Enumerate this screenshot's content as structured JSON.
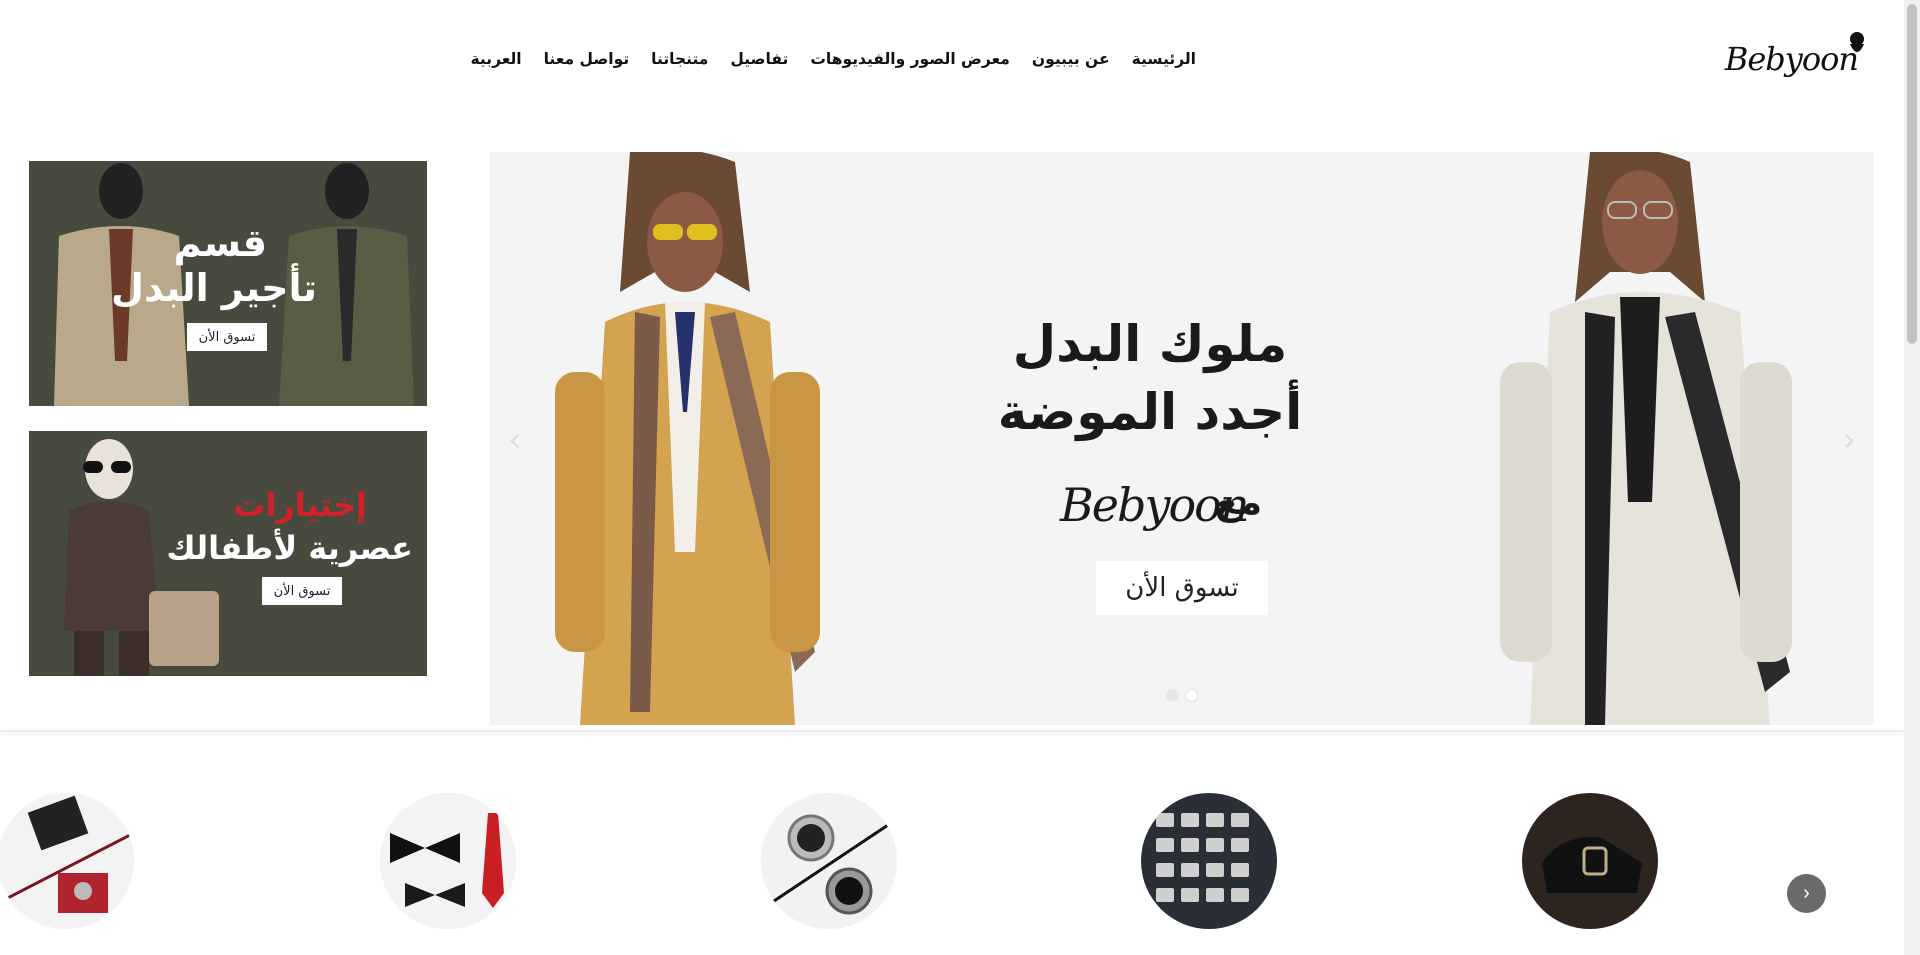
{
  "header": {
    "logo_text": "Bebyoon",
    "nav": [
      "الرئيسية",
      "عن بيبيون",
      "معرض الصور والفيديوهات",
      "تفاصيل",
      "متنجاتنا",
      "تواصل معنا",
      "العربية"
    ]
  },
  "hero": {
    "title_line1": "ملوك البدل",
    "title_line2": "أجدد الموضة",
    "with_text": "مع",
    "brand": "Bebyoon",
    "button_label": "تسوق الأن",
    "prev_icon": "chevron-left-icon",
    "next_icon": "chevron-right-icon",
    "slide_count": 2,
    "active_slide": 2
  },
  "promos": [
    {
      "line1": "قسم",
      "line2": "تأجير البدل",
      "button_label": "تسوق الأن"
    },
    {
      "line1": "إختيارات",
      "line2": "عصرية لأطفالك",
      "button_label": "تسوق الأن"
    }
  ],
  "categories": {
    "items": [
      {
        "icon": "shoes-icon",
        "label": ""
      },
      {
        "icon": "belts-icon",
        "label": ""
      },
      {
        "icon": "watches-icon",
        "label": ""
      },
      {
        "icon": "ties-icon",
        "label": ""
      },
      {
        "icon": "cufflinks-icon",
        "label": ""
      }
    ],
    "next_icon": "chevron-right-icon"
  },
  "colors": {
    "promo_bg": "#474a3c",
    "accent_red": "#d4202a",
    "hero_bg": "#f4f4f4"
  }
}
